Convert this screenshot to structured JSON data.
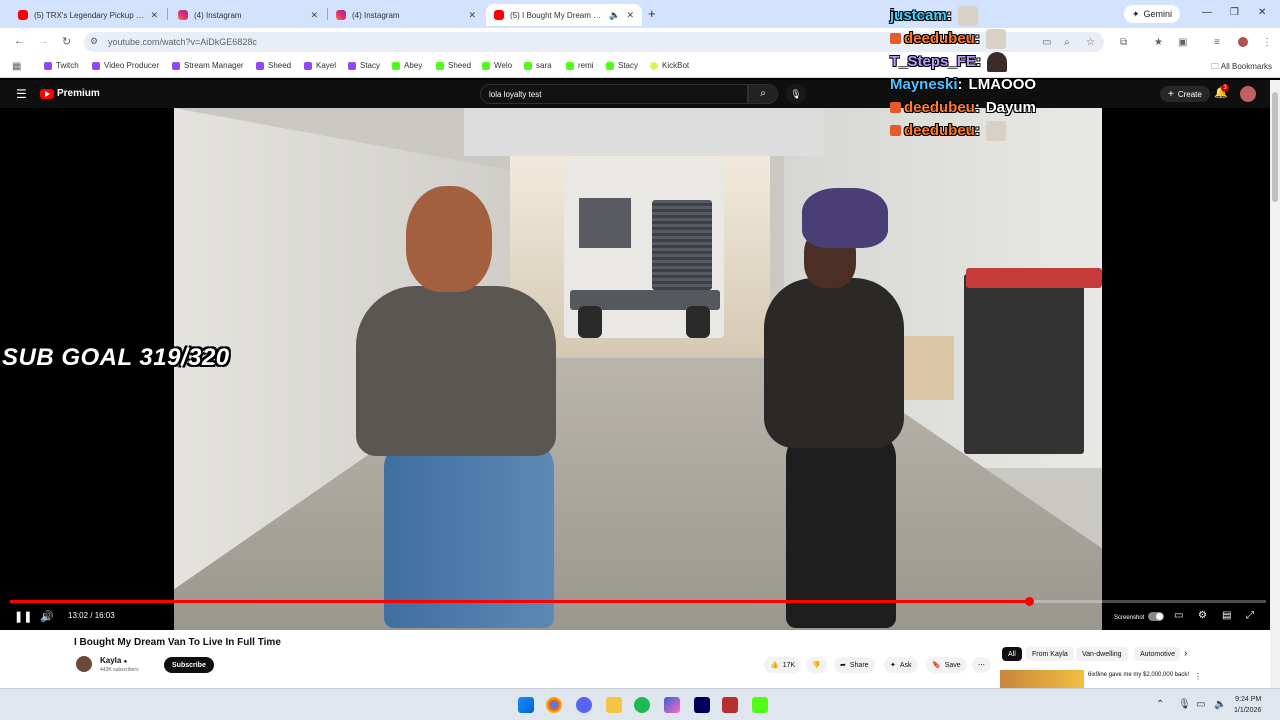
{
  "browser": {
    "tabs": [
      {
        "label": "(5) TRX's Legendary Pickup Tru",
        "favicon": "youtube-icon"
      },
      {
        "label": "(4) Instagram",
        "favicon": "instagram-icon"
      },
      {
        "label": "(4) Instagram",
        "favicon": "instagram-icon"
      },
      {
        "label": "(5) I Bought My Dream Van",
        "favicon": "youtube-icon",
        "active": true
      }
    ],
    "gemini_label": "Gemini",
    "url": "youtube.com/watch?v=AiDkGE6828c",
    "all_bookmarks_label": "All Bookmarks",
    "bookmarks": [
      {
        "label": "Twitch",
        "icon": "twitch"
      },
      {
        "label": "Video Producer",
        "icon": "twitch"
      },
      {
        "label": "Stream Manager",
        "icon": "twitch"
      },
      {
        "label": "Sheed",
        "icon": "twitch"
      },
      {
        "label": "Kayel",
        "icon": "twitch"
      },
      {
        "label": "Stacy",
        "icon": "twitch"
      },
      {
        "label": "Abey",
        "icon": "kick"
      },
      {
        "label": "Sheed",
        "icon": "kick"
      },
      {
        "label": "Welo",
        "icon": "kick"
      },
      {
        "label": "sara",
        "icon": "kick"
      },
      {
        "label": "remi",
        "icon": "kick"
      },
      {
        "label": "Stacy",
        "icon": "kick"
      },
      {
        "label": "KickBot",
        "icon": "kickbot"
      }
    ]
  },
  "youtube": {
    "logo_text": "Premium",
    "search_value": "lola loyalty test",
    "create_label": "Create",
    "notification_count": "3"
  },
  "overlay": {
    "sub_goal": "SUB GOAL 319/320",
    "chat": [
      {
        "user": "justcam",
        "color": "#3fd4ff",
        "badge": false,
        "message": "",
        "emote": "light"
      },
      {
        "user": "deedubeu",
        "color": "#ff7a2a",
        "badge": true,
        "message": "",
        "emote": "light"
      },
      {
        "user": "T_Steps_FE",
        "color": "#b99bff",
        "badge": false,
        "message": "",
        "emote": "dark"
      },
      {
        "user": "Mayneski",
        "color": "#4fc3ff",
        "badge": false,
        "message": "LMAOOO",
        "emote": ""
      },
      {
        "user": "deedubeu",
        "color": "#ff7a2a",
        "badge": true,
        "message": "Dayum",
        "emote": ""
      },
      {
        "user": "deedubeu",
        "color": "#ff7a2a",
        "badge": true,
        "message": "",
        "emote": "light"
      }
    ]
  },
  "player": {
    "time_display": "13:02 / 16:03",
    "progress": 0.811,
    "screenshot_label": "Screenshot"
  },
  "video_info": {
    "title": "I Bought My Dream Van To Live In Full Time",
    "channel": "Kayla",
    "subscribers": "443K subscribers",
    "subscribe_label": "Subscribe",
    "likes": "17K",
    "share_label": "Share",
    "ask_label": "Ask",
    "save_label": "Save"
  },
  "recommendations": {
    "chips": [
      "All",
      "From Kayla",
      "Van-dwelling",
      "Automotive"
    ],
    "first_title": "6ix9ine gave me my $2,000,000 back!"
  },
  "taskbar": {
    "time": "9:24 PM",
    "date": "1/1/2026"
  }
}
